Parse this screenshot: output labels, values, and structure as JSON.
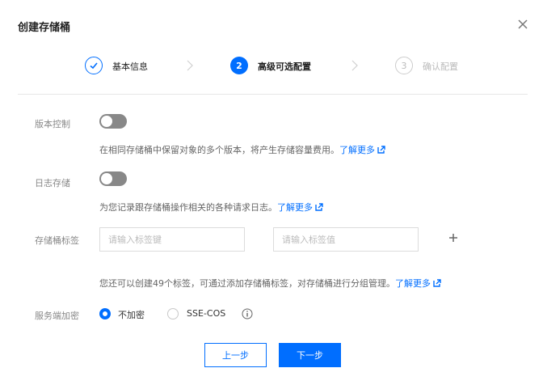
{
  "dialog": {
    "title": "创建存储桶"
  },
  "steps": [
    {
      "label": "基本信息",
      "number": "1",
      "state": "done"
    },
    {
      "label": "高级可选配置",
      "number": "2",
      "state": "active"
    },
    {
      "label": "确认配置",
      "number": "3",
      "state": "todo"
    }
  ],
  "versioning": {
    "label": "版本控制",
    "help": "在相同存储桶中保留对象的多个版本，将产生存储容量费用。",
    "link": "了解更多",
    "enabled": false
  },
  "logging": {
    "label": "日志存储",
    "help": "为您记录跟存储桶操作相关的各种请求日志。",
    "link": "了解更多",
    "enabled": false
  },
  "tags": {
    "label": "存储桶标签",
    "key_placeholder": "请输入标签键",
    "value_placeholder": "请输入标签值",
    "help": "您还可以创建49个标签，可通过添加存储桶标签，对存储桶进行分组管理。",
    "link": "了解更多",
    "add_icon": "plus-icon"
  },
  "encryption": {
    "label": "服务端加密",
    "options": [
      {
        "label": "不加密",
        "selected": true
      },
      {
        "label": "SSE-COS",
        "selected": false
      }
    ],
    "info_icon": "info-icon"
  },
  "footer": {
    "prev_label": "上一步",
    "next_label": "下一步"
  },
  "colors": {
    "accent": "#006eff",
    "toggle_off": "#888888",
    "divider": "#e6e6e6"
  }
}
